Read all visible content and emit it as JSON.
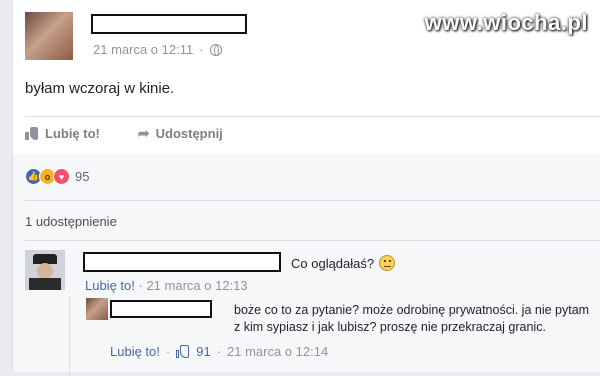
{
  "watermark": "www.wiocha.pl",
  "post": {
    "timestamp": "21 marca o 12:11",
    "text": "byłam wczoraj w kinie.",
    "actions": {
      "like": "Lubię to!",
      "share": "Udostępnij"
    },
    "reactions": {
      "count": "95",
      "types": [
        "like-icon",
        "wow-icon",
        "love-icon"
      ]
    },
    "shares": "1 udostępnienie"
  },
  "comment": {
    "text": "Co oglądałaś?",
    "like_label": "Lubię to!",
    "timestamp": "21 marca o 12:13"
  },
  "reply": {
    "text": "boże co to za pytanie? może odrobinę prywatności. ja nie pytam z kim sypiasz i jak lubisz? proszę nie przekraczaj granic.",
    "like_label": "Lubię to!",
    "likes": "91",
    "timestamp": "21 marca o 12:14"
  },
  "colors": {
    "link": "#4b67a0",
    "meta": "#90949c",
    "like_blue": "#4267b2",
    "love_red": "#f25268",
    "wow_yellow": "#f7b125"
  }
}
